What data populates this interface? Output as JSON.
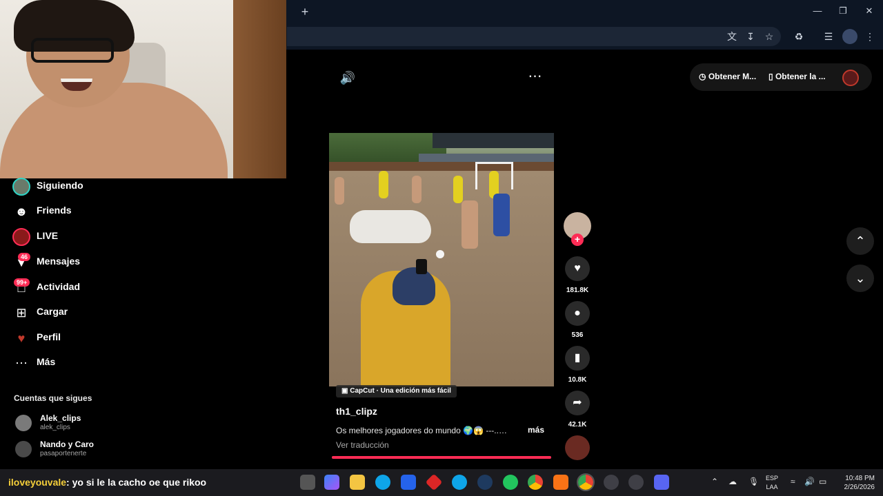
{
  "browser": {
    "new_tab_icon": "plus-icon",
    "window_controls": [
      "minimize-icon",
      "restore-icon",
      "close-icon"
    ],
    "toolbar_icons": [
      "translate-icon",
      "install-app-icon",
      "bookmark-star-icon",
      "extensions-icon",
      "media-control-icon",
      "profile-icon",
      "menu-icon"
    ]
  },
  "sidebar": {
    "items": [
      {
        "label": "Siguiendo",
        "icon": "following-avatar-icon",
        "badge": ""
      },
      {
        "label": "Friends",
        "icon": "friends-icon",
        "badge": ""
      },
      {
        "label": "LIVE",
        "icon": "live-icon",
        "badge": ""
      },
      {
        "label": "Mensajes",
        "icon": "messages-icon",
        "badge": "46"
      },
      {
        "label": "Actividad",
        "icon": "activity-icon",
        "badge": "99+"
      },
      {
        "label": "Cargar",
        "icon": "upload-icon",
        "badge": ""
      },
      {
        "label": "Perfil",
        "icon": "profile-icon",
        "badge": ""
      },
      {
        "label": "Más",
        "icon": "more-icon",
        "badge": ""
      }
    ],
    "following_title": "Cuentas que sigues",
    "accounts": [
      {
        "name": "Alek_clips",
        "handle": "alek_clips"
      },
      {
        "name": "Nando y Caro",
        "handle": "pasaportenerte"
      }
    ]
  },
  "topbar": {
    "get_app_label": "Obtener M...",
    "get_desktop_label": "Obtener la ..."
  },
  "video": {
    "capcut_label": "CapCut · Una edición más fácil",
    "author": "th1_clipz",
    "caption": "Os melhores jogadores do mundo 🌍😱 ---..…",
    "more_label": "más",
    "translate_label": "Ver traducción",
    "progress": 1.0
  },
  "actions": {
    "likes": "181.8K",
    "comments": "536",
    "saves": "10.8K",
    "shares": "42.1K"
  },
  "chat": {
    "user": "iloveyouvale",
    "message": ": yo si le la cacho oe que rikoo"
  },
  "system": {
    "lang_line1": "ESP",
    "lang_line2": "LAA",
    "time": "10:48 PM",
    "date": "2/26/2026"
  },
  "colors": {
    "accent": "#fe2c55",
    "background": "#000000",
    "chat_username": "#f5cf3a"
  }
}
